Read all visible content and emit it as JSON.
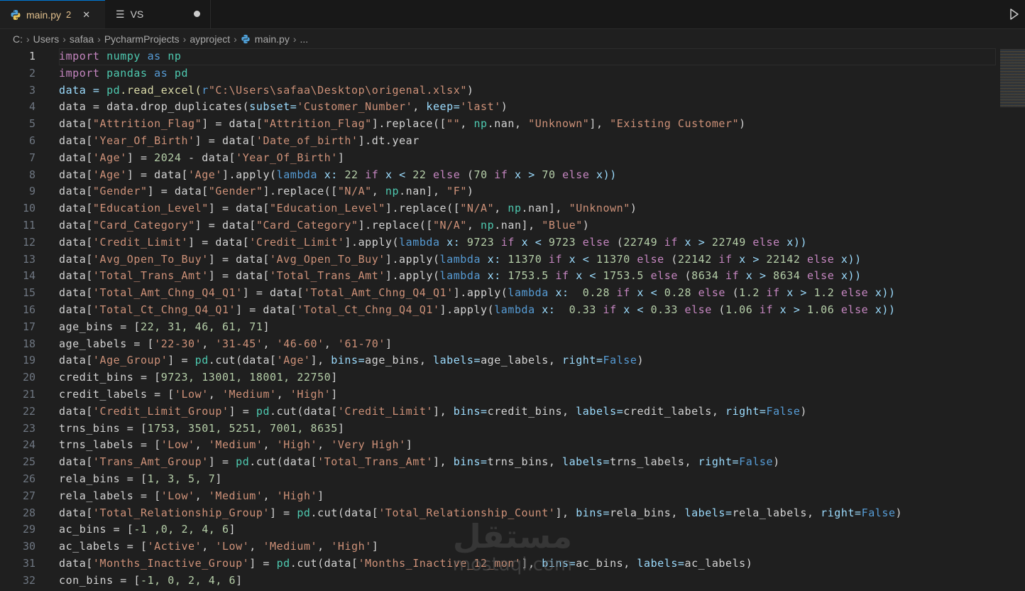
{
  "tabs": [
    {
      "label": "main.py",
      "badge": "2",
      "close": "✕",
      "icon": "python-icon"
    },
    {
      "label": "VS",
      "icon": "lines-icon"
    }
  ],
  "breadcrumb": [
    "C:",
    "Users",
    "safaa",
    "PycharmProjects",
    "ayproject",
    "main.py",
    "..."
  ],
  "code_lines": [
    [
      [
        "import",
        "#c586c0"
      ],
      [
        " ",
        "#d4d4d4"
      ],
      [
        "numpy",
        "#4ec9b0"
      ],
      [
        " as ",
        "#569cd6"
      ],
      [
        "np",
        "#4ec9b0"
      ]
    ],
    [
      [
        "import",
        "#c586c0"
      ],
      [
        " ",
        "#d4d4d4"
      ],
      [
        "pandas",
        "#4ec9b0"
      ],
      [
        " as ",
        "#569cd6"
      ],
      [
        "pd",
        "#4ec9b0"
      ]
    ],
    [
      [
        "data = ",
        "#9cdcfe"
      ],
      [
        "pd",
        "#4ec9b0"
      ],
      [
        ".read_excel(",
        "#dcdcaa"
      ],
      [
        "r",
        "#569cd6"
      ],
      [
        "\"C:\\Users\\safaa\\Desktop\\origenal.xlsx\"",
        "#ce9178"
      ],
      [
        ")",
        "#d4d4d4"
      ]
    ],
    [
      [
        "data = data.drop_duplicates(",
        "#d4d4d4"
      ],
      [
        "subset=",
        "#9cdcfe"
      ],
      [
        "'Customer_Number'",
        "#ce9178"
      ],
      [
        ", ",
        "#d4d4d4"
      ],
      [
        "keep=",
        "#9cdcfe"
      ],
      [
        "'last'",
        "#ce9178"
      ],
      [
        ")",
        "#d4d4d4"
      ]
    ],
    [
      [
        "data[",
        "#d4d4d4"
      ],
      [
        "\"Attrition_Flag\"",
        "#ce9178"
      ],
      [
        "] = data[",
        "#d4d4d4"
      ],
      [
        "\"Attrition_Flag\"",
        "#ce9178"
      ],
      [
        "].replace([",
        "#d4d4d4"
      ],
      [
        "\"\"",
        "#ce9178"
      ],
      [
        ", ",
        "#d4d4d4"
      ],
      [
        "np",
        "#4ec9b0"
      ],
      [
        ".nan, ",
        "#d4d4d4"
      ],
      [
        "\"Unknown\"",
        "#ce9178"
      ],
      [
        "], ",
        "#d4d4d4"
      ],
      [
        "\"Existing Customer\"",
        "#ce9178"
      ],
      [
        ")",
        "#d4d4d4"
      ]
    ],
    [
      [
        "data[",
        "#d4d4d4"
      ],
      [
        "'Year_Of_Birth'",
        "#ce9178"
      ],
      [
        "] = data[",
        "#d4d4d4"
      ],
      [
        "'Date_of_birth'",
        "#ce9178"
      ],
      [
        "].dt.year",
        "#d4d4d4"
      ]
    ],
    [
      [
        "data[",
        "#d4d4d4"
      ],
      [
        "'Age'",
        "#ce9178"
      ],
      [
        "] = ",
        "#d4d4d4"
      ],
      [
        "2024",
        "#b5cea8"
      ],
      [
        " - data[",
        "#d4d4d4"
      ],
      [
        "'Year_Of_Birth'",
        "#ce9178"
      ],
      [
        "]",
        "#d4d4d4"
      ]
    ],
    [
      [
        "data[",
        "#d4d4d4"
      ],
      [
        "'Age'",
        "#ce9178"
      ],
      [
        "] = data[",
        "#d4d4d4"
      ],
      [
        "'Age'",
        "#ce9178"
      ],
      [
        "].apply(",
        "#d4d4d4"
      ],
      [
        "lambda",
        "#569cd6"
      ],
      [
        " x: ",
        "#9cdcfe"
      ],
      [
        "22",
        "#b5cea8"
      ],
      [
        " if ",
        "#c586c0"
      ],
      [
        "x < ",
        "#9cdcfe"
      ],
      [
        "22",
        "#b5cea8"
      ],
      [
        " else ",
        "#c586c0"
      ],
      [
        "(",
        "#d4d4d4"
      ],
      [
        "70",
        "#b5cea8"
      ],
      [
        " if ",
        "#c586c0"
      ],
      [
        "x > ",
        "#9cdcfe"
      ],
      [
        "70",
        "#b5cea8"
      ],
      [
        " else ",
        "#c586c0"
      ],
      [
        "x))",
        "#9cdcfe"
      ]
    ],
    [
      [
        "data[",
        "#d4d4d4"
      ],
      [
        "\"Gender\"",
        "#ce9178"
      ],
      [
        "] = data[",
        "#d4d4d4"
      ],
      [
        "\"Gender\"",
        "#ce9178"
      ],
      [
        "].replace([",
        "#d4d4d4"
      ],
      [
        "\"N/A\"",
        "#ce9178"
      ],
      [
        ", ",
        "#d4d4d4"
      ],
      [
        "np",
        "#4ec9b0"
      ],
      [
        ".nan], ",
        "#d4d4d4"
      ],
      [
        "\"F\"",
        "#ce9178"
      ],
      [
        ")",
        "#d4d4d4"
      ]
    ],
    [
      [
        "data[",
        "#d4d4d4"
      ],
      [
        "\"Education_Level\"",
        "#ce9178"
      ],
      [
        "] = data[",
        "#d4d4d4"
      ],
      [
        "\"Education_Level\"",
        "#ce9178"
      ],
      [
        "].replace([",
        "#d4d4d4"
      ],
      [
        "\"N/A\"",
        "#ce9178"
      ],
      [
        ", ",
        "#d4d4d4"
      ],
      [
        "np",
        "#4ec9b0"
      ],
      [
        ".nan], ",
        "#d4d4d4"
      ],
      [
        "\"Unknown\"",
        "#ce9178"
      ],
      [
        ")",
        "#d4d4d4"
      ]
    ],
    [
      [
        "data[",
        "#d4d4d4"
      ],
      [
        "\"Card_Category\"",
        "#ce9178"
      ],
      [
        "] = data[",
        "#d4d4d4"
      ],
      [
        "\"Card_Category\"",
        "#ce9178"
      ],
      [
        "].replace([",
        "#d4d4d4"
      ],
      [
        "\"N/A\"",
        "#ce9178"
      ],
      [
        ", ",
        "#d4d4d4"
      ],
      [
        "np",
        "#4ec9b0"
      ],
      [
        ".nan], ",
        "#d4d4d4"
      ],
      [
        "\"Blue\"",
        "#ce9178"
      ],
      [
        ")",
        "#d4d4d4"
      ]
    ],
    [
      [
        "data[",
        "#d4d4d4"
      ],
      [
        "'Credit_Limit'",
        "#ce9178"
      ],
      [
        "] = data[",
        "#d4d4d4"
      ],
      [
        "'Credit_Limit'",
        "#ce9178"
      ],
      [
        "].apply(",
        "#d4d4d4"
      ],
      [
        "lambda",
        "#569cd6"
      ],
      [
        " x: ",
        "#9cdcfe"
      ],
      [
        "9723",
        "#b5cea8"
      ],
      [
        " if ",
        "#c586c0"
      ],
      [
        "x < ",
        "#9cdcfe"
      ],
      [
        "9723",
        "#b5cea8"
      ],
      [
        " else ",
        "#c586c0"
      ],
      [
        "(",
        "#d4d4d4"
      ],
      [
        "22749",
        "#b5cea8"
      ],
      [
        " if ",
        "#c586c0"
      ],
      [
        "x > ",
        "#9cdcfe"
      ],
      [
        "22749",
        "#b5cea8"
      ],
      [
        " else ",
        "#c586c0"
      ],
      [
        "x))",
        "#9cdcfe"
      ]
    ],
    [
      [
        "data[",
        "#d4d4d4"
      ],
      [
        "'Avg_Open_To_Buy'",
        "#ce9178"
      ],
      [
        "] = data[",
        "#d4d4d4"
      ],
      [
        "'Avg_Open_To_Buy'",
        "#ce9178"
      ],
      [
        "].apply(",
        "#d4d4d4"
      ],
      [
        "lambda",
        "#569cd6"
      ],
      [
        " x: ",
        "#9cdcfe"
      ],
      [
        "11370",
        "#b5cea8"
      ],
      [
        " if ",
        "#c586c0"
      ],
      [
        "x < ",
        "#9cdcfe"
      ],
      [
        "11370",
        "#b5cea8"
      ],
      [
        " else ",
        "#c586c0"
      ],
      [
        "(",
        "#d4d4d4"
      ],
      [
        "22142",
        "#b5cea8"
      ],
      [
        " if ",
        "#c586c0"
      ],
      [
        "x > ",
        "#9cdcfe"
      ],
      [
        "22142",
        "#b5cea8"
      ],
      [
        " else ",
        "#c586c0"
      ],
      [
        "x))",
        "#9cdcfe"
      ]
    ],
    [
      [
        "data[",
        "#d4d4d4"
      ],
      [
        "'Total_Trans_Amt'",
        "#ce9178"
      ],
      [
        "] = data[",
        "#d4d4d4"
      ],
      [
        "'Total_Trans_Amt'",
        "#ce9178"
      ],
      [
        "].apply(",
        "#d4d4d4"
      ],
      [
        "lambda",
        "#569cd6"
      ],
      [
        " x: ",
        "#9cdcfe"
      ],
      [
        "1753.5",
        "#b5cea8"
      ],
      [
        " if ",
        "#c586c0"
      ],
      [
        "x < ",
        "#9cdcfe"
      ],
      [
        "1753.5",
        "#b5cea8"
      ],
      [
        " else ",
        "#c586c0"
      ],
      [
        "(",
        "#d4d4d4"
      ],
      [
        "8634",
        "#b5cea8"
      ],
      [
        " if ",
        "#c586c0"
      ],
      [
        "x > ",
        "#9cdcfe"
      ],
      [
        "8634",
        "#b5cea8"
      ],
      [
        " else ",
        "#c586c0"
      ],
      [
        "x))",
        "#9cdcfe"
      ]
    ],
    [
      [
        "data[",
        "#d4d4d4"
      ],
      [
        "'Total_Amt_Chng_Q4_Q1'",
        "#ce9178"
      ],
      [
        "] = data[",
        "#d4d4d4"
      ],
      [
        "'Total_Amt_Chng_Q4_Q1'",
        "#ce9178"
      ],
      [
        "].apply(",
        "#d4d4d4"
      ],
      [
        "lambda",
        "#569cd6"
      ],
      [
        " x:  ",
        "#9cdcfe"
      ],
      [
        "0.28",
        "#b5cea8"
      ],
      [
        " if ",
        "#c586c0"
      ],
      [
        "x < ",
        "#9cdcfe"
      ],
      [
        "0.28",
        "#b5cea8"
      ],
      [
        " else ",
        "#c586c0"
      ],
      [
        "(",
        "#d4d4d4"
      ],
      [
        "1.2",
        "#b5cea8"
      ],
      [
        " if ",
        "#c586c0"
      ],
      [
        "x > ",
        "#9cdcfe"
      ],
      [
        "1.2",
        "#b5cea8"
      ],
      [
        " else ",
        "#c586c0"
      ],
      [
        "x))",
        "#9cdcfe"
      ]
    ],
    [
      [
        "data[",
        "#d4d4d4"
      ],
      [
        "'Total_Ct_Chng_Q4_Q1'",
        "#ce9178"
      ],
      [
        "] = data[",
        "#d4d4d4"
      ],
      [
        "'Total_Ct_Chng_Q4_Q1'",
        "#ce9178"
      ],
      [
        "].apply(",
        "#d4d4d4"
      ],
      [
        "lambda",
        "#569cd6"
      ],
      [
        " x:  ",
        "#9cdcfe"
      ],
      [
        "0.33",
        "#b5cea8"
      ],
      [
        " if ",
        "#c586c0"
      ],
      [
        "x < ",
        "#9cdcfe"
      ],
      [
        "0.33",
        "#b5cea8"
      ],
      [
        " else ",
        "#c586c0"
      ],
      [
        "(",
        "#d4d4d4"
      ],
      [
        "1.06",
        "#b5cea8"
      ],
      [
        " if ",
        "#c586c0"
      ],
      [
        "x > ",
        "#9cdcfe"
      ],
      [
        "1.06",
        "#b5cea8"
      ],
      [
        " else ",
        "#c586c0"
      ],
      [
        "x))",
        "#9cdcfe"
      ]
    ],
    [
      [
        "age_bins = [",
        "#d4d4d4"
      ],
      [
        "22, 31, 46, 61, 71",
        "#b5cea8"
      ],
      [
        "]",
        "#d4d4d4"
      ]
    ],
    [
      [
        "age_labels = [",
        "#d4d4d4"
      ],
      [
        "'22-30'",
        "#ce9178"
      ],
      [
        ", ",
        "#d4d4d4"
      ],
      [
        "'31-45'",
        "#ce9178"
      ],
      [
        ", ",
        "#d4d4d4"
      ],
      [
        "'46-60'",
        "#ce9178"
      ],
      [
        ", ",
        "#d4d4d4"
      ],
      [
        "'61-70'",
        "#ce9178"
      ],
      [
        "]",
        "#d4d4d4"
      ]
    ],
    [
      [
        "data[",
        "#d4d4d4"
      ],
      [
        "'Age_Group'",
        "#ce9178"
      ],
      [
        "] = ",
        "#d4d4d4"
      ],
      [
        "pd",
        "#4ec9b0"
      ],
      [
        ".cut(data[",
        "#d4d4d4"
      ],
      [
        "'Age'",
        "#ce9178"
      ],
      [
        "], ",
        "#d4d4d4"
      ],
      [
        "bins=",
        "#9cdcfe"
      ],
      [
        "age_bins, ",
        "#d4d4d4"
      ],
      [
        "labels=",
        "#9cdcfe"
      ],
      [
        "age_labels, ",
        "#d4d4d4"
      ],
      [
        "right=",
        "#9cdcfe"
      ],
      [
        "False",
        "#569cd6"
      ],
      [
        ")",
        "#d4d4d4"
      ]
    ],
    [
      [
        "credit_bins = [",
        "#d4d4d4"
      ],
      [
        "9723, 13001, 18001, 22750",
        "#b5cea8"
      ],
      [
        "]",
        "#d4d4d4"
      ]
    ],
    [
      [
        "credit_labels = [",
        "#d4d4d4"
      ],
      [
        "'Low'",
        "#ce9178"
      ],
      [
        ", ",
        "#d4d4d4"
      ],
      [
        "'Medium'",
        "#ce9178"
      ],
      [
        ", ",
        "#d4d4d4"
      ],
      [
        "'High'",
        "#ce9178"
      ],
      [
        "]",
        "#d4d4d4"
      ]
    ],
    [
      [
        "data[",
        "#d4d4d4"
      ],
      [
        "'Credit_Limit_Group'",
        "#ce9178"
      ],
      [
        "] = ",
        "#d4d4d4"
      ],
      [
        "pd",
        "#4ec9b0"
      ],
      [
        ".cut(data[",
        "#d4d4d4"
      ],
      [
        "'Credit_Limit'",
        "#ce9178"
      ],
      [
        "], ",
        "#d4d4d4"
      ],
      [
        "bins=",
        "#9cdcfe"
      ],
      [
        "credit_bins, ",
        "#d4d4d4"
      ],
      [
        "labels=",
        "#9cdcfe"
      ],
      [
        "credit_labels, ",
        "#d4d4d4"
      ],
      [
        "right=",
        "#9cdcfe"
      ],
      [
        "False",
        "#569cd6"
      ],
      [
        ")",
        "#d4d4d4"
      ]
    ],
    [
      [
        "trns_bins = [",
        "#d4d4d4"
      ],
      [
        "1753, 3501, 5251, 7001, 8635",
        "#b5cea8"
      ],
      [
        "]",
        "#d4d4d4"
      ]
    ],
    [
      [
        "trns_labels = [",
        "#d4d4d4"
      ],
      [
        "'Low'",
        "#ce9178"
      ],
      [
        ", ",
        "#d4d4d4"
      ],
      [
        "'Medium'",
        "#ce9178"
      ],
      [
        ", ",
        "#d4d4d4"
      ],
      [
        "'High'",
        "#ce9178"
      ],
      [
        ", ",
        "#d4d4d4"
      ],
      [
        "'Very High'",
        "#ce9178"
      ],
      [
        "]",
        "#d4d4d4"
      ]
    ],
    [
      [
        "data[",
        "#d4d4d4"
      ],
      [
        "'Trans_Amt_Group'",
        "#ce9178"
      ],
      [
        "] = ",
        "#d4d4d4"
      ],
      [
        "pd",
        "#4ec9b0"
      ],
      [
        ".cut(data[",
        "#d4d4d4"
      ],
      [
        "'Total_Trans_Amt'",
        "#ce9178"
      ],
      [
        "], ",
        "#d4d4d4"
      ],
      [
        "bins=",
        "#9cdcfe"
      ],
      [
        "trns_bins, ",
        "#d4d4d4"
      ],
      [
        "labels=",
        "#9cdcfe"
      ],
      [
        "trns_labels, ",
        "#d4d4d4"
      ],
      [
        "right=",
        "#9cdcfe"
      ],
      [
        "False",
        "#569cd6"
      ],
      [
        ")",
        "#d4d4d4"
      ]
    ],
    [
      [
        "rela_bins = [",
        "#d4d4d4"
      ],
      [
        "1, 3, 5, 7",
        "#b5cea8"
      ],
      [
        "]",
        "#d4d4d4"
      ]
    ],
    [
      [
        "rela_labels = [",
        "#d4d4d4"
      ],
      [
        "'Low'",
        "#ce9178"
      ],
      [
        ", ",
        "#d4d4d4"
      ],
      [
        "'Medium'",
        "#ce9178"
      ],
      [
        ", ",
        "#d4d4d4"
      ],
      [
        "'High'",
        "#ce9178"
      ],
      [
        "]",
        "#d4d4d4"
      ]
    ],
    [
      [
        "data[",
        "#d4d4d4"
      ],
      [
        "'Total_Relationship_Group'",
        "#ce9178"
      ],
      [
        "] = ",
        "#d4d4d4"
      ],
      [
        "pd",
        "#4ec9b0"
      ],
      [
        ".cut(data[",
        "#d4d4d4"
      ],
      [
        "'Total_Relationship_Count'",
        "#ce9178"
      ],
      [
        "], ",
        "#d4d4d4"
      ],
      [
        "bins=",
        "#9cdcfe"
      ],
      [
        "rela_bins, ",
        "#d4d4d4"
      ],
      [
        "labels=",
        "#9cdcfe"
      ],
      [
        "rela_labels, ",
        "#d4d4d4"
      ],
      [
        "right=",
        "#9cdcfe"
      ],
      [
        "False",
        "#569cd6"
      ],
      [
        ")",
        "#d4d4d4"
      ]
    ],
    [
      [
        "ac_bins = [",
        "#d4d4d4"
      ],
      [
        "-1 ,0, 2, 4, 6",
        "#b5cea8"
      ],
      [
        "]",
        "#d4d4d4"
      ]
    ],
    [
      [
        "ac_labels = [",
        "#d4d4d4"
      ],
      [
        "'Active'",
        "#ce9178"
      ],
      [
        ", ",
        "#d4d4d4"
      ],
      [
        "'Low'",
        "#ce9178"
      ],
      [
        ", ",
        "#d4d4d4"
      ],
      [
        "'Medium'",
        "#ce9178"
      ],
      [
        ", ",
        "#d4d4d4"
      ],
      [
        "'High'",
        "#ce9178"
      ],
      [
        "]",
        "#d4d4d4"
      ]
    ],
    [
      [
        "data[",
        "#d4d4d4"
      ],
      [
        "'Months_Inactive_Group'",
        "#ce9178"
      ],
      [
        "] = ",
        "#d4d4d4"
      ],
      [
        "pd",
        "#4ec9b0"
      ],
      [
        ".cut(data[",
        "#d4d4d4"
      ],
      [
        "'Months_Inactive_12_mon'",
        "#ce9178"
      ],
      [
        "], ",
        "#d4d4d4"
      ],
      [
        "bins=",
        "#9cdcfe"
      ],
      [
        "ac_bins, ",
        "#d4d4d4"
      ],
      [
        "labels=",
        "#9cdcfe"
      ],
      [
        "ac_labels)",
        "#d4d4d4"
      ]
    ],
    [
      [
        "con_bins = [",
        "#d4d4d4"
      ],
      [
        "-1, 0, 2, 4, 6",
        "#b5cea8"
      ],
      [
        "]",
        "#d4d4d4"
      ]
    ]
  ],
  "current_line": 1,
  "watermark": {
    "arabic": "مستقل",
    "latin": "mostaql.com"
  }
}
